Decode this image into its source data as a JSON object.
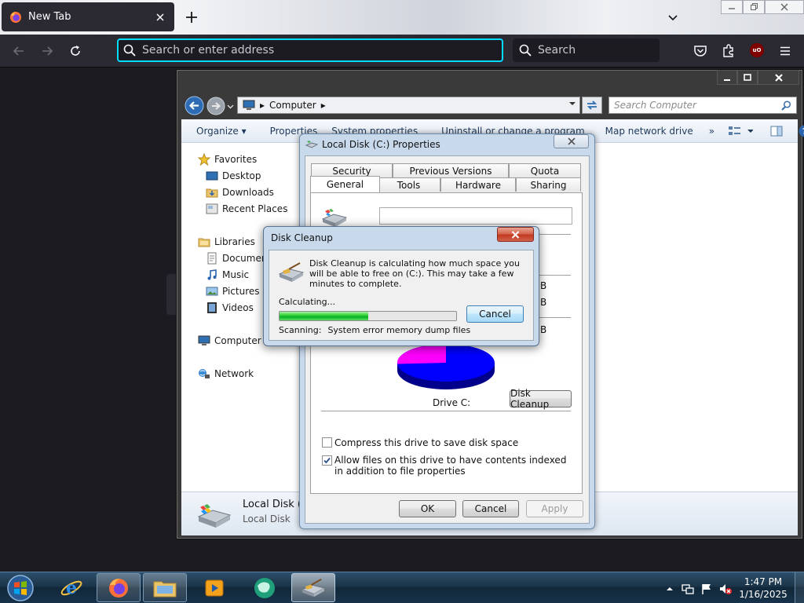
{
  "browser": {
    "tab_title": "New Tab",
    "url_placeholder": "Search or enter address",
    "search_placeholder": "Search",
    "extension_badge": "uO"
  },
  "explorer": {
    "address": {
      "root": "Computer"
    },
    "search_placeholder": "Search Computer",
    "toolbar": {
      "organize": "Organize ▾",
      "properties": "Properties",
      "system_properties": "System properties",
      "uninstall": "Uninstall or change a program",
      "map_drive": "Map network drive",
      "more": "»"
    },
    "nav": {
      "favorites": "Favorites",
      "desktop": "Desktop",
      "downloads": "Downloads",
      "recent": "Recent Places",
      "libraries": "Libraries",
      "documents": "Documents",
      "music": "Music",
      "pictures": "Pictures",
      "videos": "Videos",
      "computer": "Computer",
      "network": "Network"
    },
    "details": {
      "name": "Local Disk (C:)",
      "type": "Local Disk"
    }
  },
  "properties": {
    "title": "Local Disk (C:) Properties",
    "tabs_top": [
      "Security",
      "Previous Versions",
      "Quota"
    ],
    "tabs_bottom": [
      "General",
      "Tools",
      "Hardware",
      "Sharing"
    ],
    "drive_label": "Drive C:",
    "disk_cleanup_button": "Disk Cleanup",
    "compress_label": "Compress this drive to save disk space",
    "compress_checked": false,
    "index_label": "Allow files on this drive to have contents indexed in addition to file properties",
    "index_checked": true,
    "ok": "OK",
    "cancel": "Cancel",
    "apply": "Apply",
    "pie": {
      "used_fraction": 0.26,
      "used_color": "#ff00ff",
      "free_color": "#0000ff"
    }
  },
  "disk_cleanup": {
    "title": "Disk Cleanup",
    "message": "Disk Cleanup is calculating how much space you will be able to free on  (C:). This may take a few minutes to complete.",
    "status": "Calculating...",
    "cancel": "Cancel",
    "progress": 0.5,
    "scanning_label": "Scanning:",
    "scanning_item": "System error memory dump files"
  },
  "taskbar": {
    "time": "1:47 PM",
    "date": "1/16/2025"
  }
}
